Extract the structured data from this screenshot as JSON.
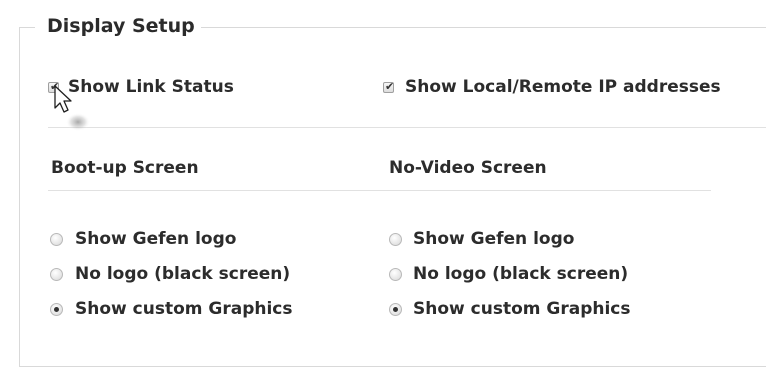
{
  "section": {
    "title": "Display Setup"
  },
  "checkboxes": [
    {
      "label": "Show Link Status",
      "checked": true
    },
    {
      "label": "Show Local/Remote IP addresses",
      "checked": true
    }
  ],
  "boot_up": {
    "heading": "Boot-up Screen",
    "options": [
      {
        "label": "Show Gefen logo",
        "selected": false
      },
      {
        "label": "No logo (black screen)",
        "selected": false
      },
      {
        "label": "Show custom Graphics",
        "selected": true
      }
    ]
  },
  "no_video": {
    "heading": "No-Video Screen",
    "options": [
      {
        "label": "Show Gefen logo",
        "selected": false
      },
      {
        "label": "No logo (black screen)",
        "selected": false
      },
      {
        "label": "Show custom Graphics",
        "selected": true
      }
    ]
  },
  "icons": {
    "check": "checkmark-icon",
    "cursor": "mouse-pointer-icon"
  }
}
